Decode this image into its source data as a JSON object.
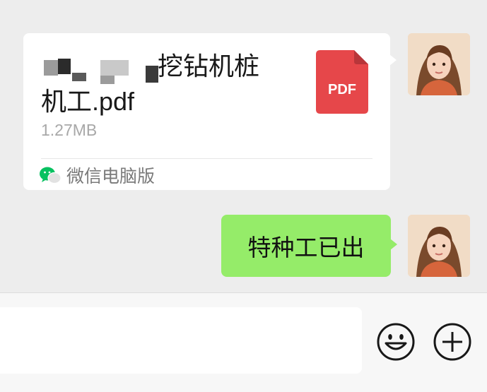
{
  "header": {
    "timestamp_fragment": ""
  },
  "messages": {
    "file": {
      "name_visible_line1": "挖钻机桩",
      "name_line2": "机工.pdf",
      "size": "1.27MB",
      "icon_label": "PDF",
      "icon_name": "pdf-file-icon",
      "icon_color": "#e6474a",
      "source_label": "微信电脑版",
      "source_icon": "wechat-icon"
    },
    "text": {
      "content": "特种工已出"
    }
  },
  "input_bar": {
    "placeholder": "",
    "emoji_icon": "emoji-icon",
    "add_icon": "plus-icon"
  },
  "colors": {
    "background": "#ededed",
    "sent_bubble": "#95ec69",
    "received_bubble": "#ffffff",
    "wechat_green": "#07c160"
  }
}
